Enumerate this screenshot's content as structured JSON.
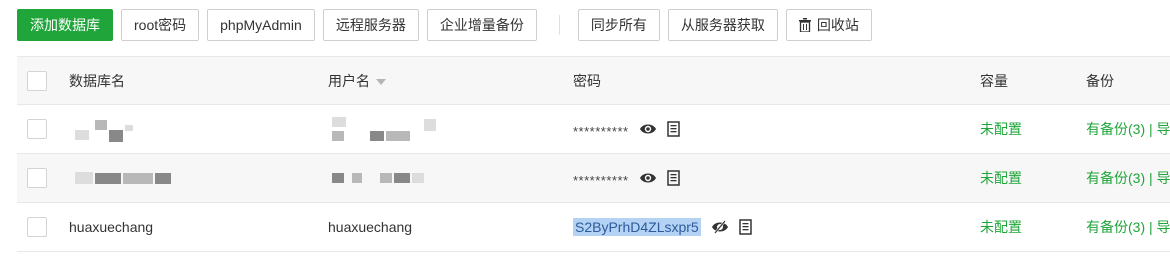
{
  "toolbar": {
    "add_db": "添加数据库",
    "root_pwd": "root密码",
    "phpmyadmin": "phpMyAdmin",
    "remote": "远程服务器",
    "enterprise_backup": "企业增量备份",
    "sync_all": "同步所有",
    "fetch_server": "从服务器获取",
    "recycle": "回收站"
  },
  "table": {
    "headers": {
      "db_name": "数据库名",
      "user_name": "用户名",
      "password": "密码",
      "capacity": "容量",
      "backup": "备份"
    },
    "rows": [
      {
        "db_name": "",
        "user_name": "",
        "password": "**********",
        "capacity": "未配置",
        "backup": "有备份(3) | 导"
      },
      {
        "db_name": "",
        "user_name": "",
        "password": "**********",
        "capacity": "未配置",
        "backup": "有备份(3) | 导"
      },
      {
        "db_name": "huaxuechang",
        "user_name": "huaxuechang",
        "password": "S2ByPrhD4ZLsxpr5",
        "capacity": "未配置",
        "backup": "有备份(3) | 导"
      }
    ]
  },
  "colors": {
    "accent": "#20a53a",
    "selection": "#b4d3f4"
  },
  "icons": [
    "eye-icon",
    "copy-icon",
    "eye-slash-icon",
    "trash-icon",
    "sort-down-icon"
  ]
}
